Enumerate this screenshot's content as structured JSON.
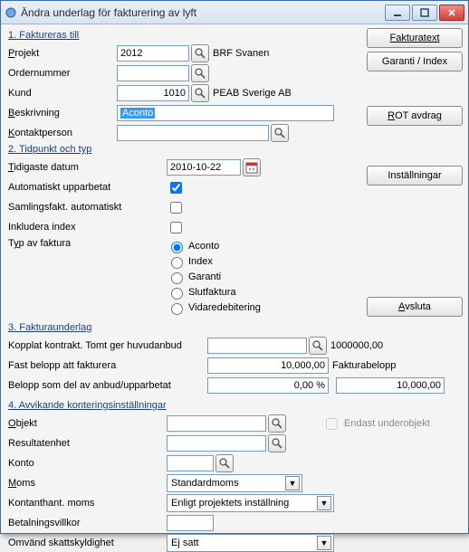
{
  "window": {
    "title": "Ändra underlag för fakturering av lyft"
  },
  "buttons": {
    "fakturatext": "Fakturatext",
    "garanti_index": "Garanti / Index",
    "rot_avdrag": "ROT avdrag",
    "rot_ul": "R",
    "installningar": "Inställningar",
    "avsluta": "Avsluta",
    "avsluta_ul": "A"
  },
  "sec1": {
    "title": "1. Faktureras till",
    "projekt_lbl": "Projekt",
    "projekt_ul": "P",
    "projekt_val": "2012",
    "projekt_text": "BRF Svanen",
    "ordernr_lbl": "Ordernummer",
    "kund_lbl": "Kund",
    "kund_val": "1010",
    "kund_text": "PEAB Sverige AB",
    "beskr_lbl": "Beskrivning",
    "beskr_ul": "B",
    "beskr_val": "Aconto",
    "kontakt_lbl": "Kontaktperson",
    "kontakt_ul": "K"
  },
  "sec2": {
    "title": "2. Tidpunkt och typ",
    "tidigaste_lbl": "Tidigaste datum",
    "tidigaste_ul": "T",
    "tidigaste_val": "2010-10-22",
    "auto_upp_lbl": "Automatiskt upparbetat",
    "saml_lbl": "Samlingsfakt. automatiskt",
    "inkl_idx_lbl": "Inkludera index",
    "typ_lbl": "Typ av faktura",
    "typ_ul": "y",
    "opts": [
      "Aconto",
      "Index",
      "Garanti",
      "Slutfaktura",
      "Vidaredebitering"
    ],
    "selected": "Aconto"
  },
  "sec3": {
    "title": "3. Fakturaunderlag",
    "kopplat_lbl": "Kopplat kontrakt. Tomt ger huvudanbud",
    "kopplat_text": "1000000,00",
    "fast_lbl": "Fast belopp att fakturera",
    "fast_val": "10,000,00",
    "fakturabelopp_lbl": "Fakturabelopp",
    "belopp_del_lbl": "Belopp som del av anbud/upparbetat",
    "belopp_del_val": "0,00 %",
    "belopp_right": "10,000,00"
  },
  "sec4": {
    "title": "4. Avvikande konteringsinställningar",
    "objekt_lbl": "Objekt",
    "objekt_ul": "O",
    "endast_lbl": "Endast underobjekt",
    "resultat_lbl": "Resultatenhet",
    "konto_lbl": "Konto",
    "moms_lbl": "Moms",
    "moms_ul": "M",
    "moms_val": "Standardmoms",
    "kontant_lbl": "Kontanthant. moms",
    "kontant_val": "Enligt projektets inställning",
    "betal_lbl": "Betalningsvillkor",
    "omv_lbl": "Omvänd skattskyldighet",
    "omv_val": "Ej satt"
  }
}
